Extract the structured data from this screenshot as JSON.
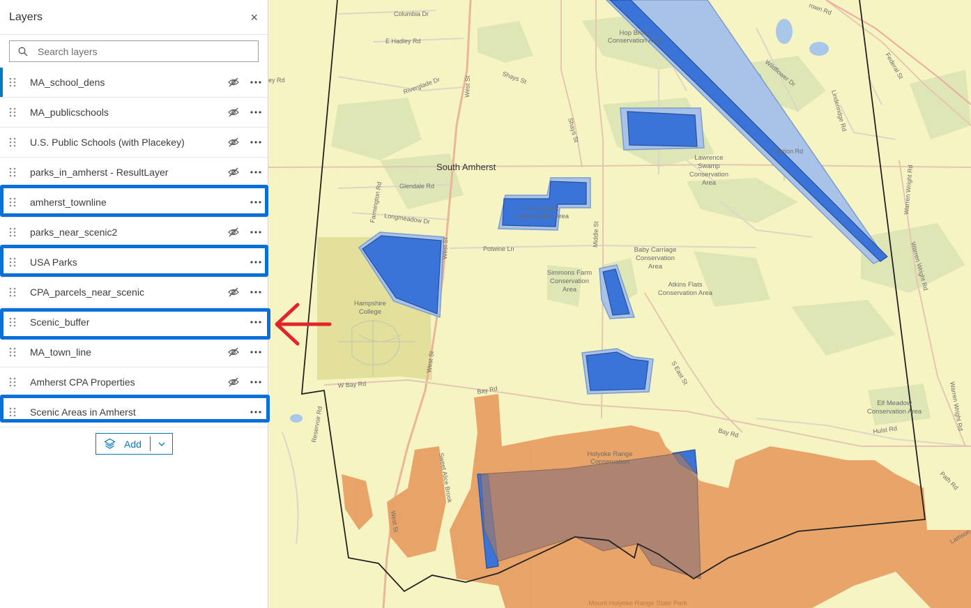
{
  "panel": {
    "title": "Layers",
    "close_label": "×",
    "search_placeholder": "Search layers",
    "add_label": "Add"
  },
  "layers": [
    {
      "label": "MA_school_dens",
      "hidden": true
    },
    {
      "label": "MA_publicschools",
      "hidden": true
    },
    {
      "label": "U.S. Public Schools (with Placekey)",
      "hidden": true
    },
    {
      "label": "parks_in_amherst - ResultLayer",
      "hidden": true
    },
    {
      "label": "amherst_townline",
      "hidden": false
    },
    {
      "label": "parks_near_scenic2",
      "hidden": true
    },
    {
      "label": "USA Parks",
      "hidden": false
    },
    {
      "label": "CPA_parcels_near_scenic",
      "hidden": true
    },
    {
      "label": "Scenic_buffer",
      "hidden": false
    },
    {
      "label": "MA_town_line",
      "hidden": true
    },
    {
      "label": "Amherst CPA Properties",
      "hidden": true
    },
    {
      "label": "Scenic Areas in Amherst",
      "hidden": false
    }
  ],
  "colors": {
    "accent": "#0079c1",
    "highlight": "#0a6fd6",
    "annotation_arrow": "#e3242b",
    "scenic_fill": "#3a74d8",
    "park_fill": "#e8a064"
  },
  "map": {
    "place_label": "South Amherst",
    "roads": {
      "columbia": "Columbia Dr",
      "e_hadley": "E Hadley Rd",
      "ey": "ey Rd",
      "shays_st": "Shays St",
      "shays_rd": "Shays St",
      "west_st_n": "West St",
      "west_st_m": "West St",
      "west_st_s": "West St",
      "middle_st": "Middle St",
      "glendale": "Glendale Rd",
      "longmeadow": "Longmeadow Dr",
      "farmington": "Farmington Rd",
      "riverglade": "Riverglade Dr",
      "potwine": "Potwine Ln",
      "w_bay": "W Bay Rd",
      "bay_w": "Bay Rd",
      "bay_e": "Bay Rd",
      "s_east": "S East St",
      "station": "Station Rd",
      "federal": "Federal St",
      "rown": "rown Rd",
      "lindenridge": "Lindenridge Rd",
      "wildflower": "Wildflower Dr",
      "warren_wright_1": "Warren Wright Rd",
      "warren_wright_2": "Warren Wright Rd",
      "warren_wright_3": "Warren Wright Rd",
      "hulst": "Hulst Rd",
      "path": "Path Rd",
      "lamson": "Lamson",
      "reservoir": "Reservoir Rd",
      "sweet_alice": "Sweet Alice Brook"
    },
    "areas": {
      "hop_brook": [
        "Hop Brook",
        "Conservation Area"
      ],
      "plum_brook": [
        "Plum Brook",
        "Conservation Area"
      ],
      "lawrence": [
        "Lawrence",
        "Swamp",
        "Conservation",
        "Area"
      ],
      "baby_carriage": [
        "Baby Carriage",
        "Conservation",
        "Area"
      ],
      "simmons": [
        "Simmons Farm",
        "Conservation",
        "Area"
      ],
      "atkins": [
        "Atkins Flats",
        "Conservation Area"
      ],
      "hampshire": [
        "Hampshire",
        "College"
      ],
      "elf_meadow": [
        "Elf Meadow",
        "Conservation Area"
      ],
      "holyoke": [
        "Holyoke Range",
        "Conservation"
      ],
      "mount_holyoke": "Mount Holyoke Range State Park"
    }
  }
}
